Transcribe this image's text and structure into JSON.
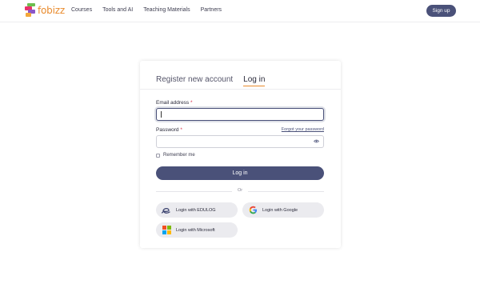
{
  "header": {
    "logo_text": "fobizz",
    "nav": [
      "Courses",
      "Tools and AI",
      "Teaching Materials",
      "Partners"
    ],
    "signup_label": "Sign up"
  },
  "card": {
    "tabs": [
      "Register new account",
      "Log in"
    ],
    "active_tab": "Log in",
    "email_label": "Email address",
    "email_value": "",
    "password_label": "Password",
    "password_value": "",
    "required_mark": "*",
    "forgot_label": "Forgot your password",
    "remember_label": "Remember me",
    "login_label": "Log in",
    "or_label": "Or",
    "social": {
      "edulog": "Login with EDULOG",
      "google": "Login with Google",
      "microsoft": "Login with Microsoft"
    }
  },
  "colors": {
    "primary": "#4a5179",
    "accent": "#e98b2d",
    "required": "#d9304b"
  }
}
